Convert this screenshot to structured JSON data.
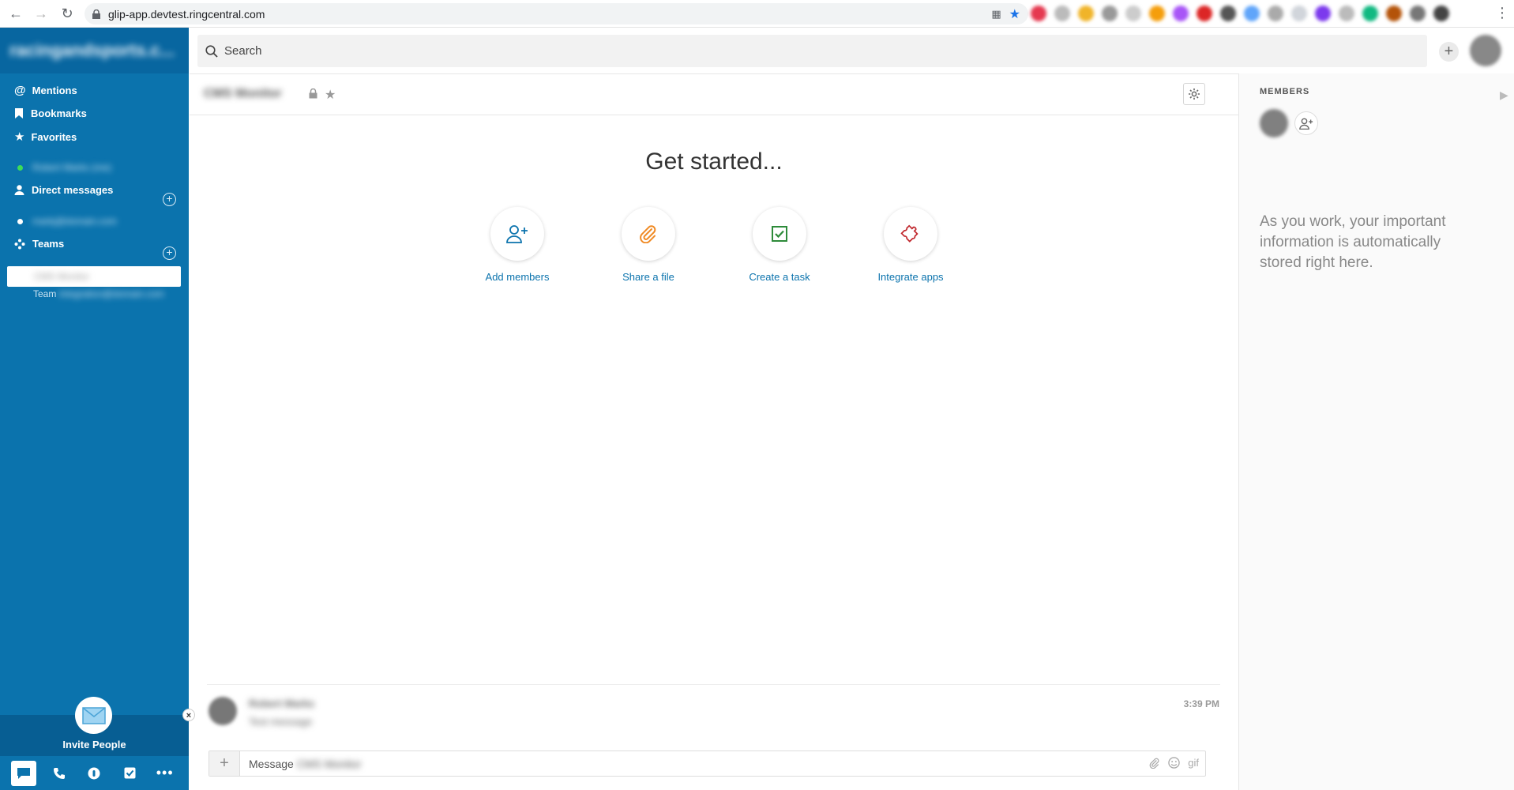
{
  "browser": {
    "url": "glip-app.devtest.ringcentral.com"
  },
  "sidebar": {
    "brand": "racingandsports.c...",
    "mentions": "Mentions",
    "bookmarks": "Bookmarks",
    "favorites": "Favorites",
    "favorite_contact": "Robert Marks (me)",
    "direct_messages": "Direct messages",
    "dm_contact": "markj@domain.com",
    "teams": "Teams",
    "team_selected": "CMS Monitor",
    "team_prefix": "Team",
    "team_other": "integration@domain.com",
    "invite_label": "Invite People",
    "accent": "#0b73ad"
  },
  "search": {
    "placeholder": "Search"
  },
  "conversation": {
    "title": "CMS Monitor"
  },
  "main": {
    "heading": "Get started...",
    "actions": [
      {
        "label": "Add members",
        "icon": "add-person-icon",
        "color": "#0b73ad"
      },
      {
        "label": "Share a file",
        "icon": "paperclip-icon",
        "color": "#f08a24"
      },
      {
        "label": "Create a task",
        "icon": "checkbox-icon",
        "color": "#2e8b3a"
      },
      {
        "label": "Integrate apps",
        "icon": "puzzle-icon",
        "color": "#c0272d"
      }
    ]
  },
  "message": {
    "author": "Robert Marks",
    "text": "Test message",
    "time": "3:39 PM"
  },
  "composer": {
    "prefix": "Message",
    "target": "CMS Monitor",
    "gif": "gif"
  },
  "right_panel": {
    "members_title": "MEMBERS",
    "info": "As you work, your important information is automatically stored right here."
  }
}
